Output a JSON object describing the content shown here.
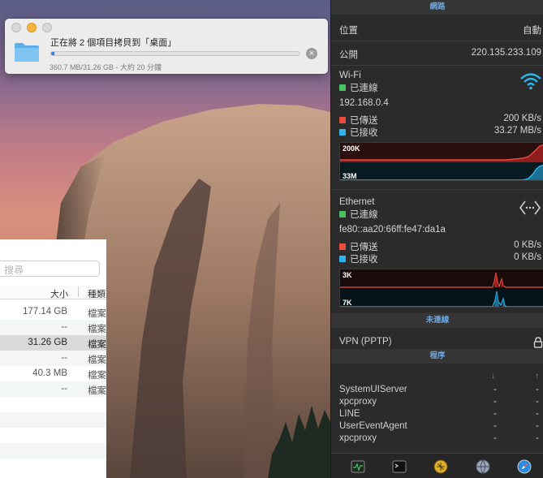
{
  "copy_dialog": {
    "title": "正在將 2 個項目拷貝到「桌面」",
    "status": "360.7 MB/31.26 GB - 大約 20 分鐘",
    "progress_fraction": 0.012
  },
  "finder": {
    "search_placeholder": "搜尋",
    "columns": {
      "size": "大小",
      "kind": "種類"
    },
    "rows": [
      {
        "size": "177.14 GB",
        "kind": "檔案"
      },
      {
        "size": "--",
        "kind": "檔案"
      },
      {
        "size": "31.26 GB",
        "kind": "檔案"
      },
      {
        "size": "--",
        "kind": "檔案"
      },
      {
        "size": "40.3 MB",
        "kind": "檔案"
      },
      {
        "size": "--",
        "kind": "檔案"
      }
    ]
  },
  "panel": {
    "network_header": "網路",
    "location_label": "位置",
    "location_value": "自動",
    "public_label": "公開",
    "public_ip": "220.135.233.109",
    "wifi": {
      "title": "Wi-Fi",
      "status": "已連線",
      "ip": "192.168.0.4",
      "sent_label": "已傳送",
      "sent_value": "200 KB/s",
      "recv_label": "已接收",
      "recv_value": "33.27 MB/s",
      "graph_up_label": "200K",
      "graph_down_label": "33M"
    },
    "ethernet": {
      "title": "Ethernet",
      "status": "已連線",
      "ip": "fe80::aa20:66ff:fe47:da1a",
      "sent_label": "已傳送",
      "sent_value": "0 KB/s",
      "recv_label": "已接收",
      "recv_value": "0 KB/s",
      "graph_up_label": "3K",
      "graph_down_label": "7K"
    },
    "disconnected_header": "未連線",
    "vpn_label": "VPN (PPTP)",
    "processes_header": "程序",
    "processes": [
      {
        "name": "SystemUIServer",
        "down": "-",
        "up": "-"
      },
      {
        "name": "xpcproxy",
        "down": "-",
        "up": "-"
      },
      {
        "name": "LINE",
        "down": "-",
        "up": "-"
      },
      {
        "name": "UserEventAgent",
        "down": "-",
        "up": "-"
      },
      {
        "name": "xpcproxy",
        "down": "-",
        "up": "-"
      }
    ],
    "toolbar_icons": [
      "activity-monitor-icon",
      "terminal-icon",
      "console-icon",
      "network-utility-icon",
      "safari-icon"
    ]
  },
  "colors": {
    "accent": "#2f82e8",
    "panel_bg": "#2b2b2b",
    "header_text": "#6ea7e0",
    "sent": "#ee4b3c",
    "received": "#2fb4ec",
    "connected": "#49c361"
  }
}
